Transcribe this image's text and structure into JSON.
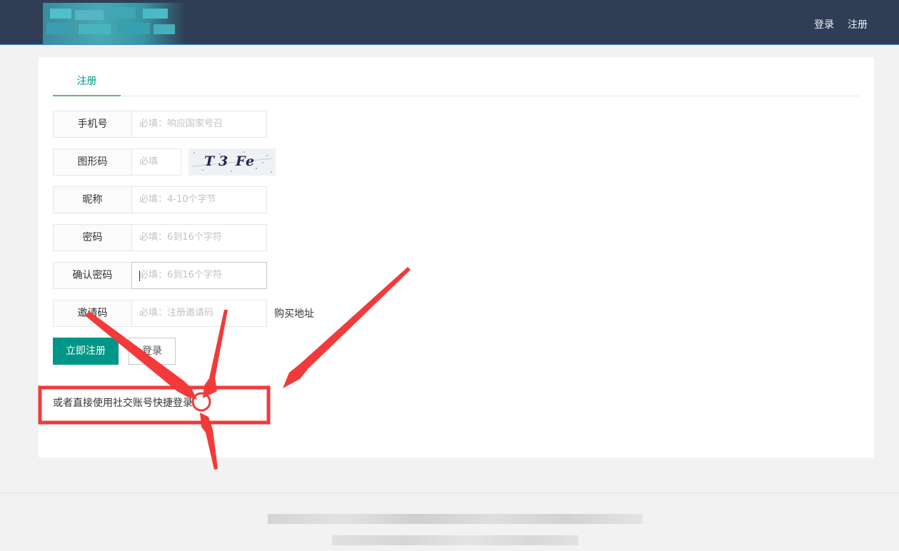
{
  "header": {
    "nav": {
      "login": "登录",
      "register": "注册"
    }
  },
  "tabs": [
    {
      "label": "注册"
    }
  ],
  "form": {
    "phone": {
      "label": "手机号",
      "placeholder": "必填：响应国家号召"
    },
    "captcha": {
      "label": "图形码",
      "placeholder": "必填",
      "image_text": [
        "T",
        "3",
        "F",
        "e"
      ]
    },
    "nickname": {
      "label": "昵称",
      "placeholder": "必填：4-10个字节"
    },
    "password": {
      "label": "密码",
      "placeholder": "必填：6到16个字符"
    },
    "confirm": {
      "label": "确认密码",
      "placeholder": "必填：6到16个字符"
    },
    "invite": {
      "label": "邀请码",
      "placeholder": "必填：注册邀请码",
      "link": "购买地址"
    },
    "submit_label": "立即注册",
    "login_label": "登录"
  },
  "social_login": "或者直接使用社交账号快捷登录",
  "colors": {
    "header_bg": "#2f3e55",
    "accent": "#009688",
    "tab_underline": "#5fb878",
    "annotation_red": "#f23a3a"
  }
}
